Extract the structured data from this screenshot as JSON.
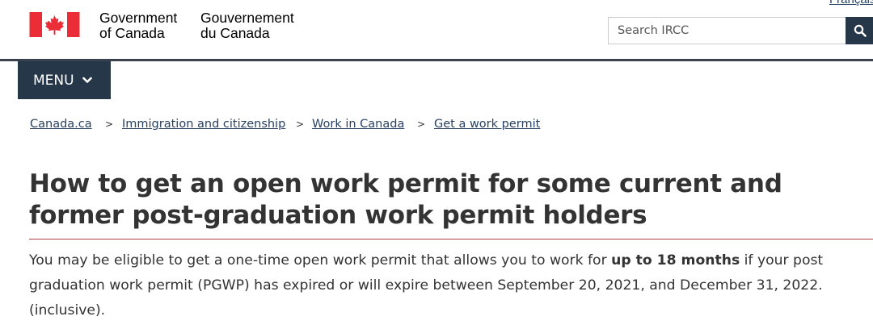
{
  "header": {
    "language_link": "Français",
    "signature_en": [
      "Government",
      "of Canada"
    ],
    "signature_fr": [
      "Gouvernement",
      "du Canada"
    ],
    "search_placeholder": "Search IRCC",
    "search_icon": "magnifier-icon",
    "flag_icon": "canada-flag-icon"
  },
  "nav": {
    "menu_label": "MENU",
    "menu_icon": "chevron-down-icon"
  },
  "breadcrumb": {
    "items": [
      "Canada.ca",
      "Immigration and citizenship",
      "Work in Canada",
      "Get a work permit"
    ],
    "separator": ">"
  },
  "main": {
    "title": "How to get an open work permit for some current and former post-graduation work permit holders",
    "intro": {
      "before": "You may be eligible to get a one-time open work permit that allows you to work for ",
      "bold": "up to 18 months",
      "after": " if your post graduation work permit (PGWP) has expired or will expire between September 20, 2021, and December 31, 2022. (inclusive)."
    }
  },
  "colors": {
    "brand_dark": "#26374a",
    "flag_red": "#eb2d37",
    "link": "#284162",
    "title_rule": "#af3c43",
    "text": "#333333"
  }
}
